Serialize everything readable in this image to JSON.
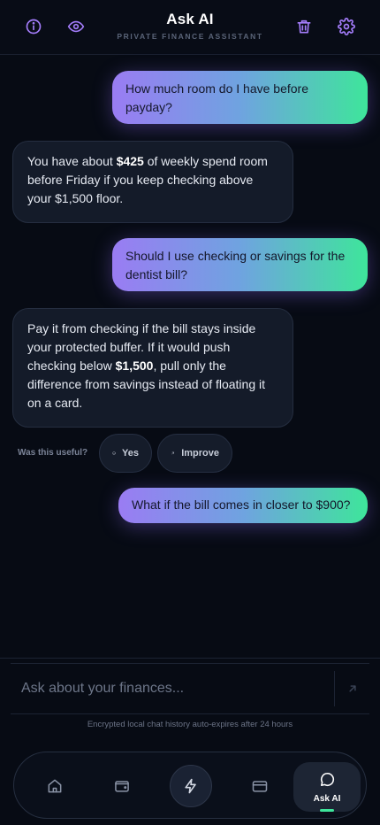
{
  "header": {
    "title": "Ask AI",
    "subtitle": "PRIVATE FINANCE ASSISTANT",
    "accent_color": "#a47dfb",
    "icons": [
      "info-icon",
      "eye-icon",
      "trash-icon",
      "gear-icon"
    ]
  },
  "messages": [
    {
      "role": "user",
      "text": "How much room do I have before payday?"
    },
    {
      "role": "ai",
      "parts": [
        "You have about ",
        "$425",
        " of weekly spend room before Friday if you keep checking above your $1,500 floor."
      ]
    },
    {
      "role": "user",
      "text": "Should I use checking or savings for the dentist bill?"
    },
    {
      "role": "ai",
      "parts": [
        "Pay it from checking if the bill stays inside your protected buffer. If it would push checking below ",
        "$1,500",
        ", pull only the difference from savings instead of floating it on a card."
      ]
    },
    {
      "role": "user",
      "text": "What if the bill comes in closer to $900?"
    }
  ],
  "feedback": {
    "label": "Was this useful?",
    "yes_label": "Yes",
    "improve_label": "Improve"
  },
  "composer": {
    "placeholder": "Ask about your finances...",
    "value": "",
    "footnote": "Encrypted local chat history auto-expires after 24 hours"
  },
  "nav": {
    "items": [
      {
        "icon": "home-icon"
      },
      {
        "icon": "wallet-icon"
      },
      {
        "icon": "lightning-icon"
      },
      {
        "icon": "credit-card-icon"
      },
      {
        "icon": "chat-icon",
        "label": "Ask AI",
        "active": true
      }
    ],
    "indicator_color": "#3ee59b"
  }
}
